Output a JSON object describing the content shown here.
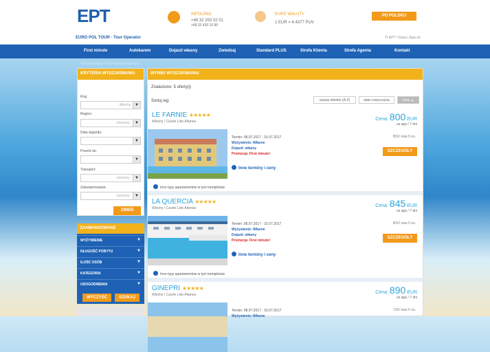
{
  "header": {
    "logo": "EPT",
    "logo_sub": "EURO POL TOUR - Tour Operator",
    "phone_label": "INFOLINIA",
    "phone_1": "+48 32 253 02 01",
    "phone_2": "+48 32 420 10 90",
    "currency_label": "KURS WALUTY",
    "currency_value": "1 EUR = 4.4377 PLN",
    "lang_button": "PO POLSKU",
    "account": "Tr EPT / Gracz Joye on"
  },
  "nav": [
    "First minute",
    "Autokarem",
    "Dojazd własny",
    "Zwiedzaj",
    "Standard PLUS",
    "Strefa Klienta",
    "Strefa Agenta",
    "Kontakt"
  ],
  "breadcrumb": "Strona główna > Wyniki wyszukiwania",
  "sidebar": {
    "title": "KRYTERIA WYSZUKIWANIA",
    "fields": [
      {
        "label": "Kraj:",
        "value": "Włochy"
      },
      {
        "label": "Region:",
        "value": "-dowolny-"
      },
      {
        "label": "Data wyjazdu:",
        "value": ""
      },
      {
        "label": "Powrót do:",
        "value": ""
      },
      {
        "label": "Transport:",
        "value": "-dowolny-"
      },
      {
        "label": "Zakwaterowanie:",
        "value": "-dowolny-"
      }
    ],
    "change_button": "ZMIEŃ",
    "adv_title": "ZAAWANSOWANE",
    "adv_items": [
      "WYŻYWIENIE",
      "DŁUGOŚĆ POBYTU",
      "ILOŚĆ OSÓB",
      "KATEGORIA",
      "UDOGODNIENIA"
    ],
    "clear_button": "WYCZYŚĆ",
    "search_button": "SZUKAJ"
  },
  "results": {
    "title": "WYNIKI WYSZUKIWANIA",
    "found": "Znaleziono: 5 oferty(i)",
    "sort_label": "Sortuj wg:",
    "sort_options": [
      "nazwa obiektu (A-Z)",
      "data rozpoczęcia",
      "cena"
    ],
    "offers": [
      {
        "name": "LE FARNIE",
        "stars": "★★★★★",
        "location": "Włochy / Caorle Lido Altanea",
        "price_label": "Cena:",
        "price": "800",
        "currency": "EUR",
        "per": "za app / 7 dni",
        "term": "Termin: 08.07.2017 - 15.07.2017",
        "food": "Wyżywienie: Własne",
        "transport": "Dojazd: własny",
        "promo": "Promocja: First minute!",
        "bsv": "BSV max 5 os.",
        "details": "SZCZEGÓŁY",
        "more": "Inne terminy i ceny",
        "types": "Inne typy apartamentów w tym kompleksie"
      },
      {
        "name": "LA QUERCIA",
        "stars": "★★★★★",
        "location": "Włochy / Caorle Lido Altanea",
        "price_label": "Cena:",
        "price": "845",
        "currency": "EUR",
        "per": "za app / 7 dni",
        "term": "Termin: 08.07.2017 - 15.07.2017",
        "food": "Wyżywienie: Własne",
        "transport": "Dojazd: własny",
        "promo": "Promocja: First minute!",
        "bsv": "BSV max 5 os.",
        "details": "SZCZEGÓŁY",
        "more": "Inne terminy i ceny",
        "types": "Inne typy apartamentów w tym kompleksie"
      },
      {
        "name": "GINEPRI",
        "stars": "★★★★★",
        "location": "Włochy / Caorle Lido Altanea",
        "price_label": "Cena:",
        "price": "890",
        "currency": "EUR",
        "per": "za app / 7 dni",
        "term": "Termin: 08.07.2017 - 15.07.2017",
        "food": "Wyżywienie: Własne",
        "transport": "",
        "promo": "",
        "bsv": "C6V max 6 os.",
        "details": "",
        "more": "",
        "types": ""
      }
    ]
  }
}
